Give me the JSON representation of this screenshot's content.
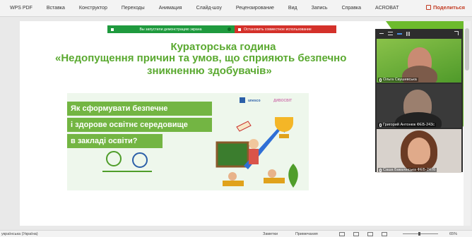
{
  "ribbon": {
    "tabs": [
      "WPS PDF",
      "Вставка",
      "Конструктор",
      "Переходы",
      "Анимация",
      "Слайд-шоу",
      "Рецензирование",
      "Вид",
      "Запись",
      "Справка",
      "ACROBAT"
    ],
    "share_label": "Поделиться"
  },
  "share_bar": {
    "sharing_text": "Вы запустили демонстрацию экрана",
    "stop_label": "Остановить совместное использование"
  },
  "slide": {
    "title_line1": "Кураторська година",
    "title_line2": "«Недопущення причин та умов, що сприяють безпечно",
    "title_line3": "зникненню здобувачів»",
    "banner_line1": "Як сформувати безпечне",
    "banner_line2": "і здорове освітнє середовище",
    "banner_line3": "в закладі освіти?",
    "brand_unesco": "unesco",
    "brand_partner": "ДИВОСВІТ"
  },
  "participants": [
    {
      "name": "Ольга Свушевська"
    },
    {
      "name": "Григорий Антонюк ФЕБ-243с"
    },
    {
      "name": "Саша Бакалінська ФЕБ-247б"
    }
  ],
  "statusbar": {
    "language": "українська (Україна)",
    "notes": "Заметки",
    "comments": "Примечания",
    "zoom": "65%"
  },
  "colors": {
    "accent_green": "#5aa930",
    "share_red": "#d4312a",
    "share_green": "#1f9a3e"
  }
}
